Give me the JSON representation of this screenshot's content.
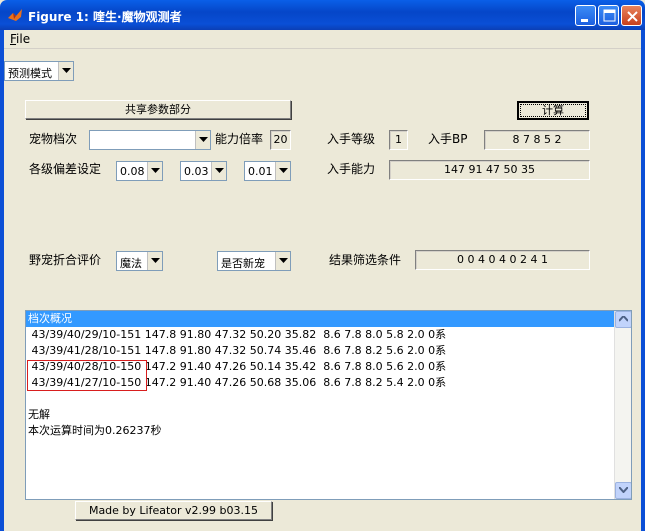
{
  "window": {
    "title": "Figure 1: 喹生·魔物观测者"
  },
  "menu": {
    "file": "File"
  },
  "mode_select": {
    "value": "预测模式"
  },
  "shared_params_button": "共享参数部分",
  "calc_button": "计算",
  "pet_grade": {
    "label": "宠物档次",
    "value": ""
  },
  "ability_multiplier": {
    "label": "能力倍率",
    "value": "20"
  },
  "acquire_level": {
    "label": "入手等级",
    "value": "1"
  },
  "acquire_bp": {
    "label": "入手BP",
    "value": "8 7 8 5 2"
  },
  "deviation": {
    "label": "各级偏差设定",
    "values": [
      "0.08",
      "0.03",
      "0.01"
    ]
  },
  "acquire_ability": {
    "label": "入手能力",
    "value": "147 91 47 50 35"
  },
  "wild_eval": {
    "label": "野宠折合评价",
    "value": "魔法"
  },
  "is_new_pet": {
    "value": "是否新宠"
  },
  "filter": {
    "label": "结果筛选条件",
    "value": "0 0 4 0 4 0 2 4 1"
  },
  "results": {
    "lines": [
      "档次概况",
      " 43/39/40/29/10-151 147.8 91.80 47.32 50.20 35.82  8.6 7.8 8.0 5.8 2.0 0系",
      " 43/39/41/28/10-151 147.8 91.80 47.32 50.74 35.46  8.6 7.8 8.2 5.6 2.0 0系",
      " 43/39/40/28/10-150 147.2 91.40 47.26 50.14 35.42  8.6 7.8 8.0 5.6 2.0 0系",
      " 43/39/41/27/10-150 147.2 91.40 47.26 50.68 35.06  8.6 7.8 8.2 5.4 2.0 0系",
      "",
      "无解",
      "本次运算时间为0.26237秒"
    ]
  },
  "made_by_button": "Made by Lifeator   v2.99 b03.15",
  "icons": {
    "app": "matlab-figure-icon",
    "minimize": "minimize-icon",
    "maximize": "maximize-icon",
    "close": "close-icon"
  }
}
